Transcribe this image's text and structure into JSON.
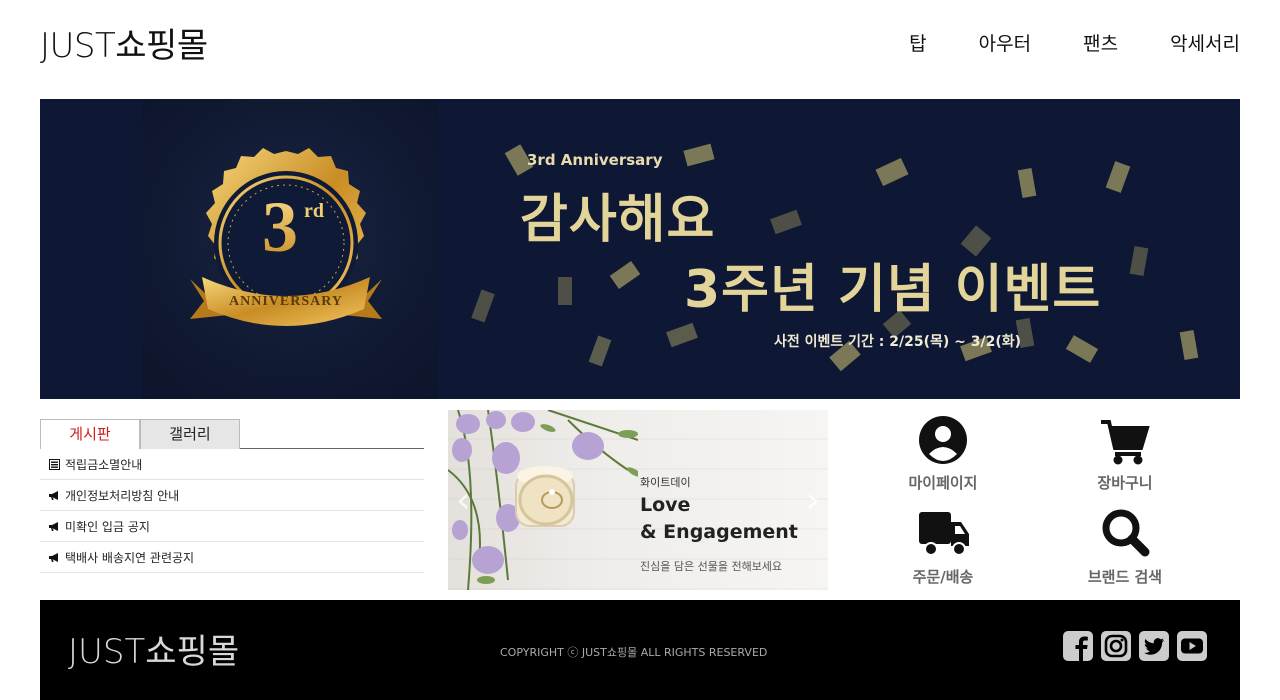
{
  "header": {
    "logo": "JUST쇼핑몰",
    "nav": [
      "탑",
      "아우터",
      "팬츠",
      "악세서리"
    ]
  },
  "banner": {
    "badge_number": "3",
    "badge_suffix": "rd",
    "badge_ribbon": "ANNIVERSARY",
    "subtitle": "3rd Anniversary",
    "title_line1": "감사해요",
    "title_line2": "3주년 기념 이벤트",
    "date_text": "사전 이벤트 기간 : 2/25(목) ~ 3/2(화)",
    "colors": {
      "background": "#0e1733",
      "gold": "#e3d59a"
    }
  },
  "board": {
    "tabs": [
      "게시판",
      "갤러리"
    ],
    "active_tab": "게시판",
    "posts": [
      {
        "icon": "list-icon",
        "title": "적립금소멸안내"
      },
      {
        "icon": "megaphone-icon",
        "title": "개인정보처리방침 안내"
      },
      {
        "icon": "megaphone-icon",
        "title": "미확인 입금 공지"
      },
      {
        "icon": "megaphone-icon",
        "title": "택배사 배송지연 관련공지"
      }
    ]
  },
  "promo": {
    "small": "화이트데이",
    "line1": "Love",
    "line2": "&  Engagement",
    "desc": "진심을 담은 선물을 전해보세요"
  },
  "quick_menu": [
    {
      "icon": "user-icon",
      "label": "마이페이지"
    },
    {
      "icon": "cart-icon",
      "label": "장바구니"
    },
    {
      "icon": "truck-icon",
      "label": "주문/배송"
    },
    {
      "icon": "search-icon",
      "label": "브랜드 검색"
    }
  ],
  "footer": {
    "logo": "JUST쇼핑몰",
    "copyright": "COPYRIGHT ⓒ JUST쇼핑몰 ALL RIGHTS RESERVED",
    "socials": [
      "facebook-icon",
      "instagram-icon",
      "twitter-icon",
      "youtube-icon"
    ]
  }
}
